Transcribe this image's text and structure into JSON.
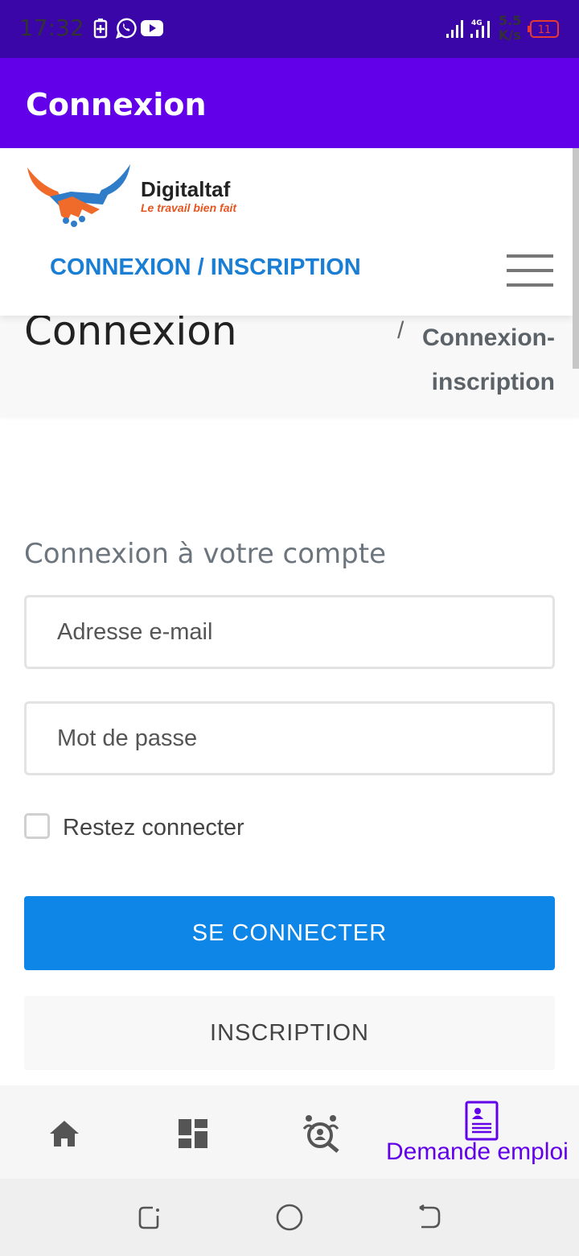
{
  "status_bar": {
    "time": "17:32",
    "net_speed_value": "5.5",
    "net_speed_unit": "K/s",
    "network_type": "4G",
    "battery_level": "11",
    "battery_color": "#e53935",
    "icons": [
      "battery-saver-icon",
      "whatsapp-icon",
      "youtube-icon",
      "signal-icon",
      "signal-4g-icon",
      "battery-icon"
    ]
  },
  "app_bar": {
    "title": "Connexion",
    "color": "#6200ea"
  },
  "site_header": {
    "logo_name": "Digitaltaf",
    "logo_tagline": "Le travail bien fait",
    "nav_link": "CONNEXION / INSCRIPTION",
    "nav_color": "#1a7fd4"
  },
  "page": {
    "title": "Connexion",
    "breadcrumb_separator": "/",
    "breadcrumb_current_line1": "Connexion-",
    "breadcrumb_current_line2": "inscription"
  },
  "form": {
    "heading": "Connexion à votre compte",
    "email_placeholder": "Adresse e-mail",
    "password_placeholder": "Mot de passe",
    "remember_label": "Restez connecter",
    "remember_checked": false,
    "submit_label": "SE CONNECTER",
    "register_label": "INSCRIPTION",
    "primary_color": "#0d86e7"
  },
  "bottom_nav": {
    "items": [
      {
        "icon": "home-icon"
      },
      {
        "icon": "dashboard-icon"
      },
      {
        "icon": "job-search-icon"
      },
      {
        "icon": "resume-icon",
        "label": "Demande emploi",
        "active": true
      }
    ],
    "active_color": "#6200ea"
  },
  "system_nav": {
    "icons": [
      "recent-apps-icon",
      "home-circle-icon",
      "back-icon"
    ]
  }
}
